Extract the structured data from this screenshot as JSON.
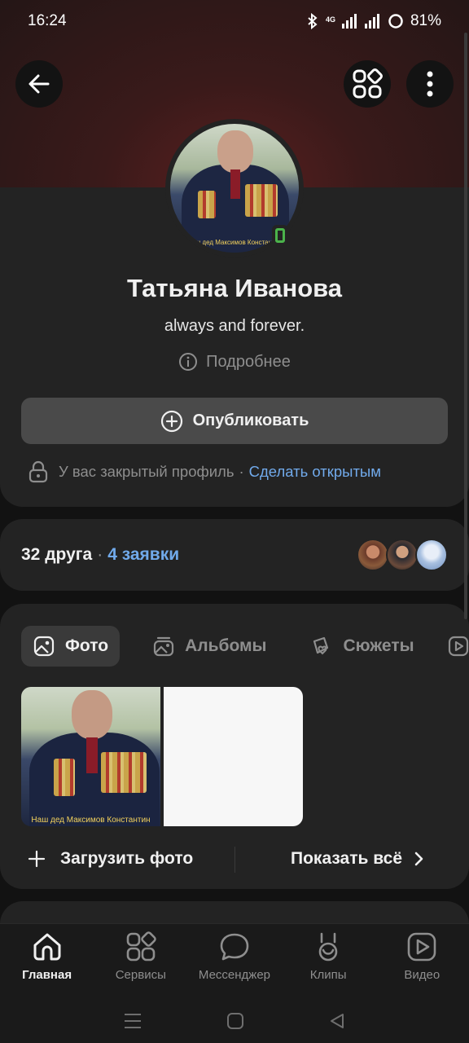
{
  "status_bar": {
    "time": "16:24",
    "network": "4G",
    "battery": "81%"
  },
  "header": {
    "back_icon": "arrow-left-icon",
    "services_icon": "grid-icon",
    "more_icon": "more-vertical-icon"
  },
  "profile": {
    "avatar_caption": "Наш дед Максимов Константин",
    "name": "Татьяна Иванова",
    "status": "always and forever.",
    "more_info": "Подробнее",
    "publish_label": "Опубликовать",
    "privacy_text": "У вас закрытый профиль",
    "privacy_separator": "·",
    "privacy_link": "Сделать открытым"
  },
  "friends": {
    "count_label": "32 друга",
    "separator": "·",
    "requests_label": "4 заявки"
  },
  "photos": {
    "tabs": [
      {
        "label": "Фото",
        "icon": "image-icon"
      },
      {
        "label": "Альбомы",
        "icon": "album-icon"
      },
      {
        "label": "Сюжеты",
        "icon": "story-icon"
      },
      {
        "label": "",
        "icon": "video-icon"
      }
    ],
    "photo_caption": "Наш дед Максимов Константин",
    "upload_label": "Загрузить фото",
    "show_all_label": "Показать всё"
  },
  "bottom_nav": [
    {
      "label": "Главная",
      "icon": "home-icon"
    },
    {
      "label": "Сервисы",
      "icon": "services-icon"
    },
    {
      "label": "Мессенджер",
      "icon": "chat-icon"
    },
    {
      "label": "Клипы",
      "icon": "clips-icon"
    },
    {
      "label": "Видео",
      "icon": "video-icon"
    }
  ],
  "colors": {
    "background": "#121212",
    "card": "#232323",
    "accent_link": "#71aaeb",
    "online": "#4bb34b"
  }
}
